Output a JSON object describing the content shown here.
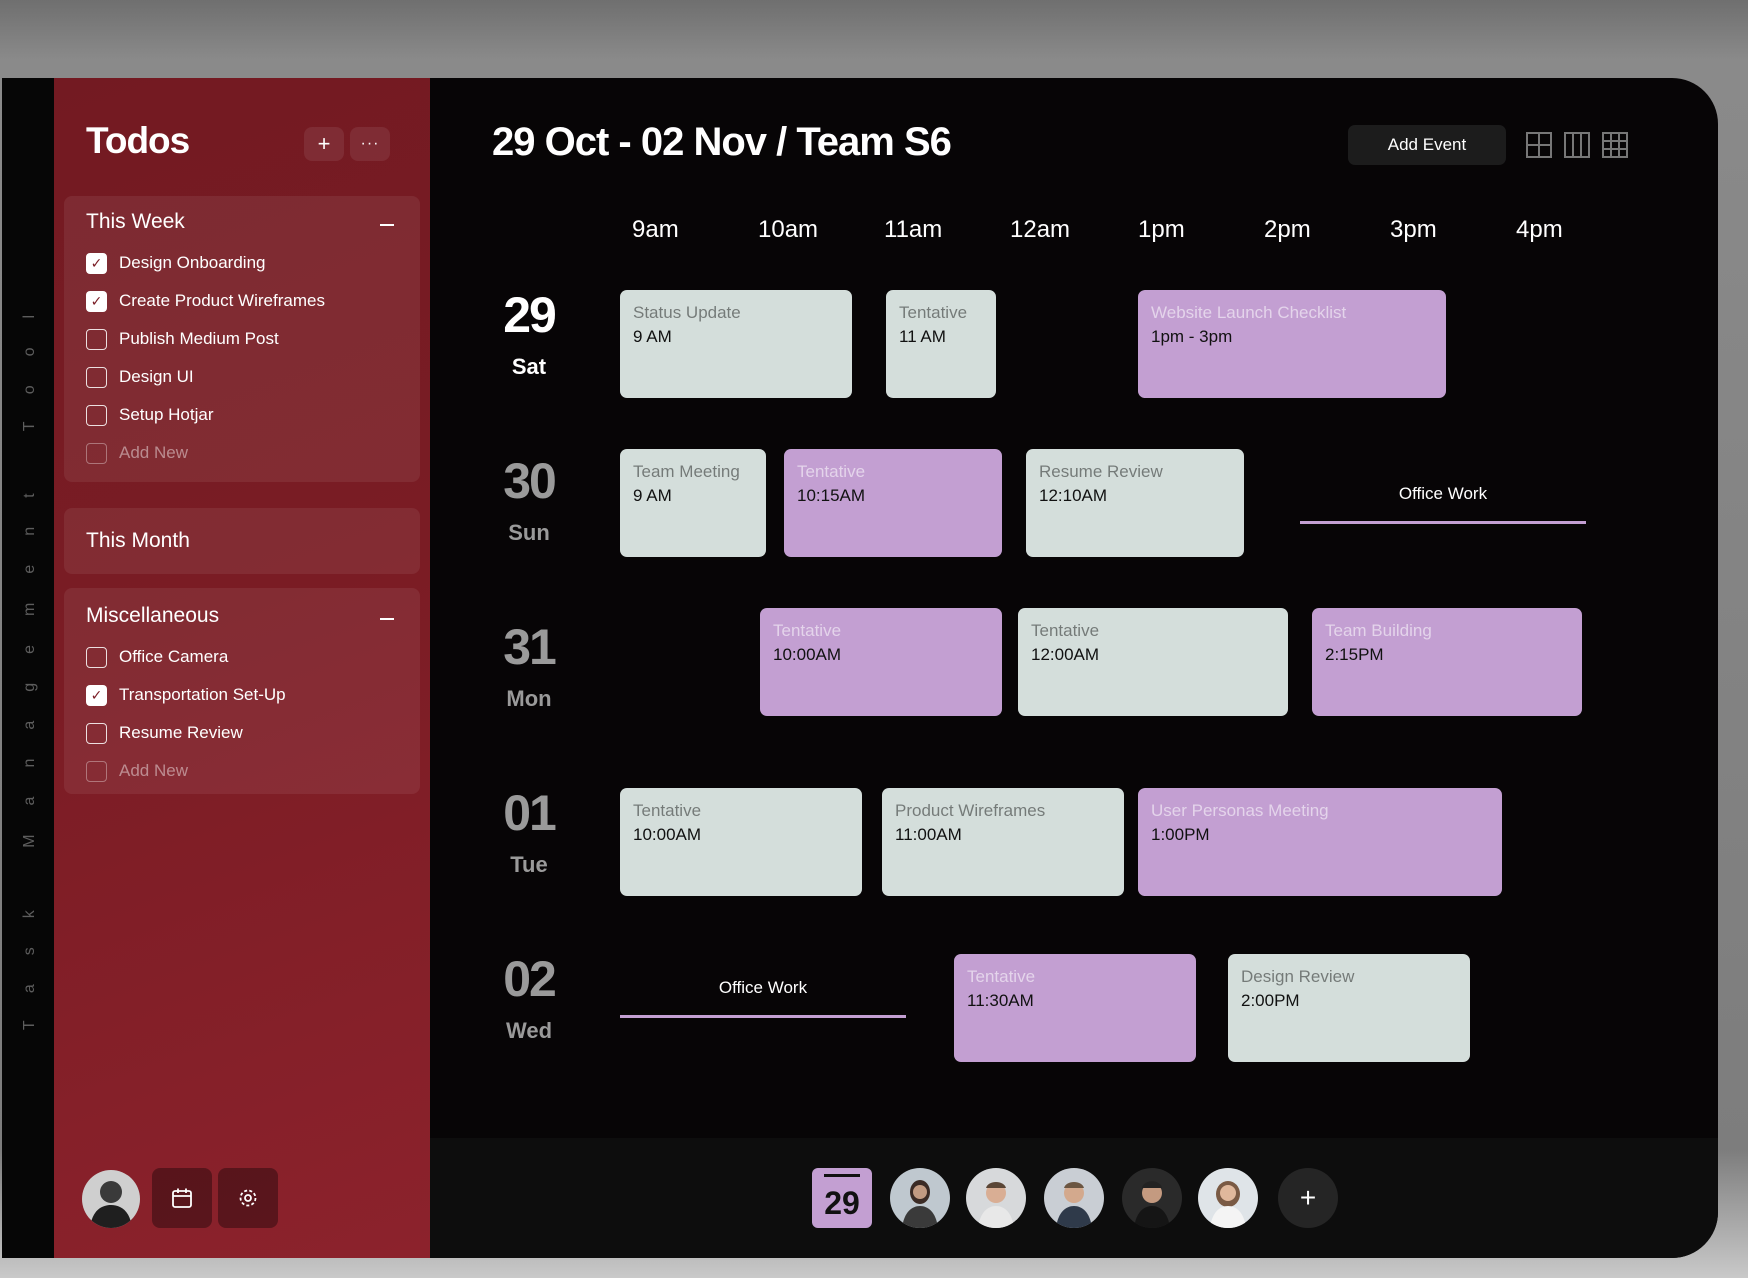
{
  "side_strip": {
    "text": "Task Management Tool"
  },
  "sidebar": {
    "title": "Todos",
    "add_icon": "plus-icon",
    "more_icon": "more-icon",
    "this_week": {
      "heading": "This Week",
      "items": [
        {
          "label": "Design Onboarding",
          "checked": true
        },
        {
          "label": "Create Product Wireframes",
          "checked": true
        },
        {
          "label": "Publish Medium Post",
          "checked": false
        },
        {
          "label": "Design UI",
          "checked": false
        },
        {
          "label": "Setup Hotjar",
          "checked": false
        }
      ],
      "add_new": "Add New"
    },
    "this_month": {
      "heading": "This Month"
    },
    "misc": {
      "heading": "Miscellaneous",
      "items": [
        {
          "label": "Office Camera",
          "checked": false
        },
        {
          "label": "Transportation Set-Up",
          "checked": true
        },
        {
          "label": "Resume Review",
          "checked": false
        }
      ],
      "add_new": "Add New"
    },
    "bottom": {
      "calendar_icon": "calendar-icon",
      "settings_icon": "gear-icon"
    }
  },
  "header": {
    "title": "29 Oct - 02 Nov / Team S6",
    "add_event": "Add Event",
    "views": [
      "grid-2x2-icon",
      "columns-icon",
      "grid-3x3-icon"
    ]
  },
  "timeline": {
    "hours": [
      "9am",
      "10am",
      "11am",
      "12am",
      "1pm",
      "2pm",
      "3pm",
      "4pm"
    ],
    "days": [
      {
        "num": "29",
        "name": "Sat"
      },
      {
        "num": "30",
        "name": "Sun"
      },
      {
        "num": "31",
        "name": "Mon"
      },
      {
        "num": "01",
        "name": "Tue"
      },
      {
        "num": "02",
        "name": "Wed"
      }
    ],
    "events": {
      "sat": [
        {
          "title": "Status Update",
          "time": "9 AM"
        },
        {
          "title": "Tentative",
          "time": "11 AM"
        },
        {
          "title": "Website Launch Checklist",
          "time": "1pm - 3pm"
        }
      ],
      "sun": [
        {
          "title": "Team Meeting",
          "time": "9 AM"
        },
        {
          "title": "Tentative",
          "time": "10:15AM"
        },
        {
          "title": "Resume Review",
          "time": "12:10AM"
        },
        {
          "title": "Office Work"
        }
      ],
      "mon": [
        {
          "title": "Tentative",
          "time": "10:00AM"
        },
        {
          "title": "Tentative",
          "time": "12:00AM"
        },
        {
          "title": "Team Building",
          "time": "2:15PM"
        }
      ],
      "tue": [
        {
          "title": "Tentative",
          "time": "10:00AM"
        },
        {
          "title": "Product Wireframes",
          "time": "11:00AM"
        },
        {
          "title": "User Personas Meeting",
          "time": "1:00PM"
        }
      ],
      "wed": [
        {
          "title": "Office Work"
        },
        {
          "title": "Tentative",
          "time": "11:30AM"
        },
        {
          "title": "Design Review",
          "time": "2:00PM"
        }
      ]
    }
  },
  "bottom_bar": {
    "date": "29",
    "members": [
      "avatar-1",
      "avatar-2",
      "avatar-3",
      "avatar-4",
      "avatar-5"
    ],
    "add_icon": "plus-icon"
  },
  "colors": {
    "accent": "#c39fd2",
    "card": "#d4dedb",
    "sidebar": "#7a1c24"
  }
}
